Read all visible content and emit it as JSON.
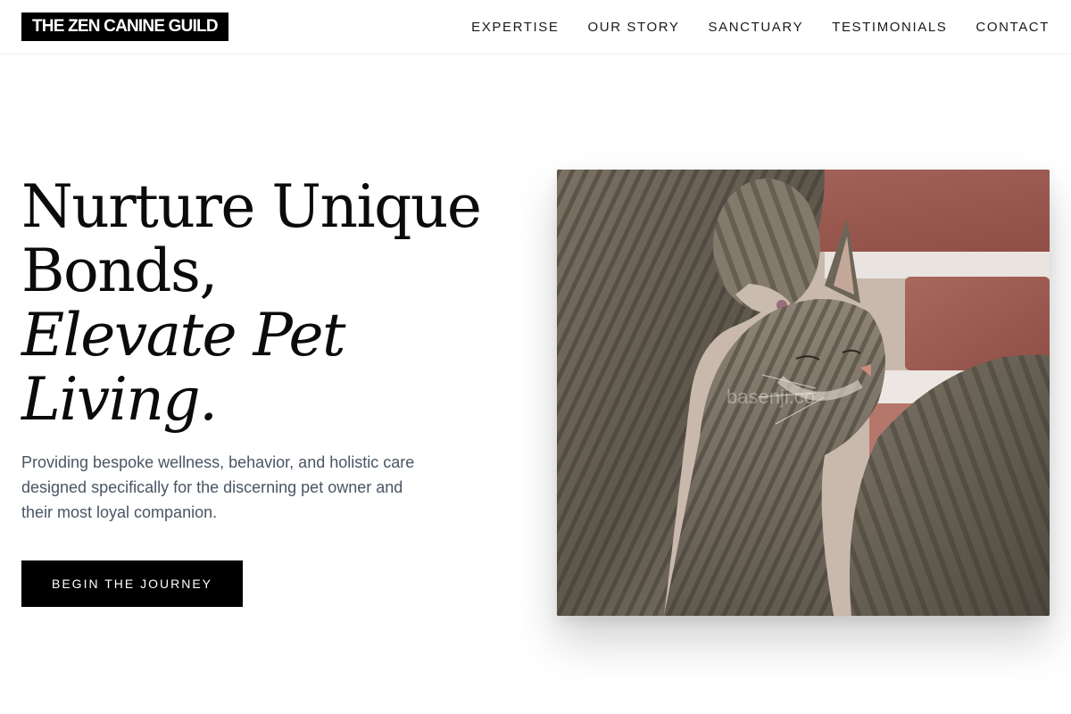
{
  "brand": {
    "logo_text": "THE ZEN CANINE GUILD"
  },
  "nav": {
    "items": [
      {
        "label": "EXPERTISE"
      },
      {
        "label": "OUR STORY"
      },
      {
        "label": "SANCTUARY"
      },
      {
        "label": "TESTIMONIALS"
      },
      {
        "label": "CONTACT"
      }
    ]
  },
  "hero": {
    "headline_line1": "Nurture Unique",
    "headline_line2": "Bonds,",
    "headline_italic_line1": "Elevate Pet",
    "headline_italic_line2": "Living.",
    "subtext": "Providing bespoke wellness, behavior, and holistic care designed specifically for the discerning pet owner and their most loyal companion.",
    "cta_label": "BEGIN THE JOURNEY",
    "image_watermark": "basenji.co"
  },
  "colors": {
    "brand_black": "#000000",
    "body_text": "#4a5564",
    "heading_text": "#0b0b0b"
  }
}
